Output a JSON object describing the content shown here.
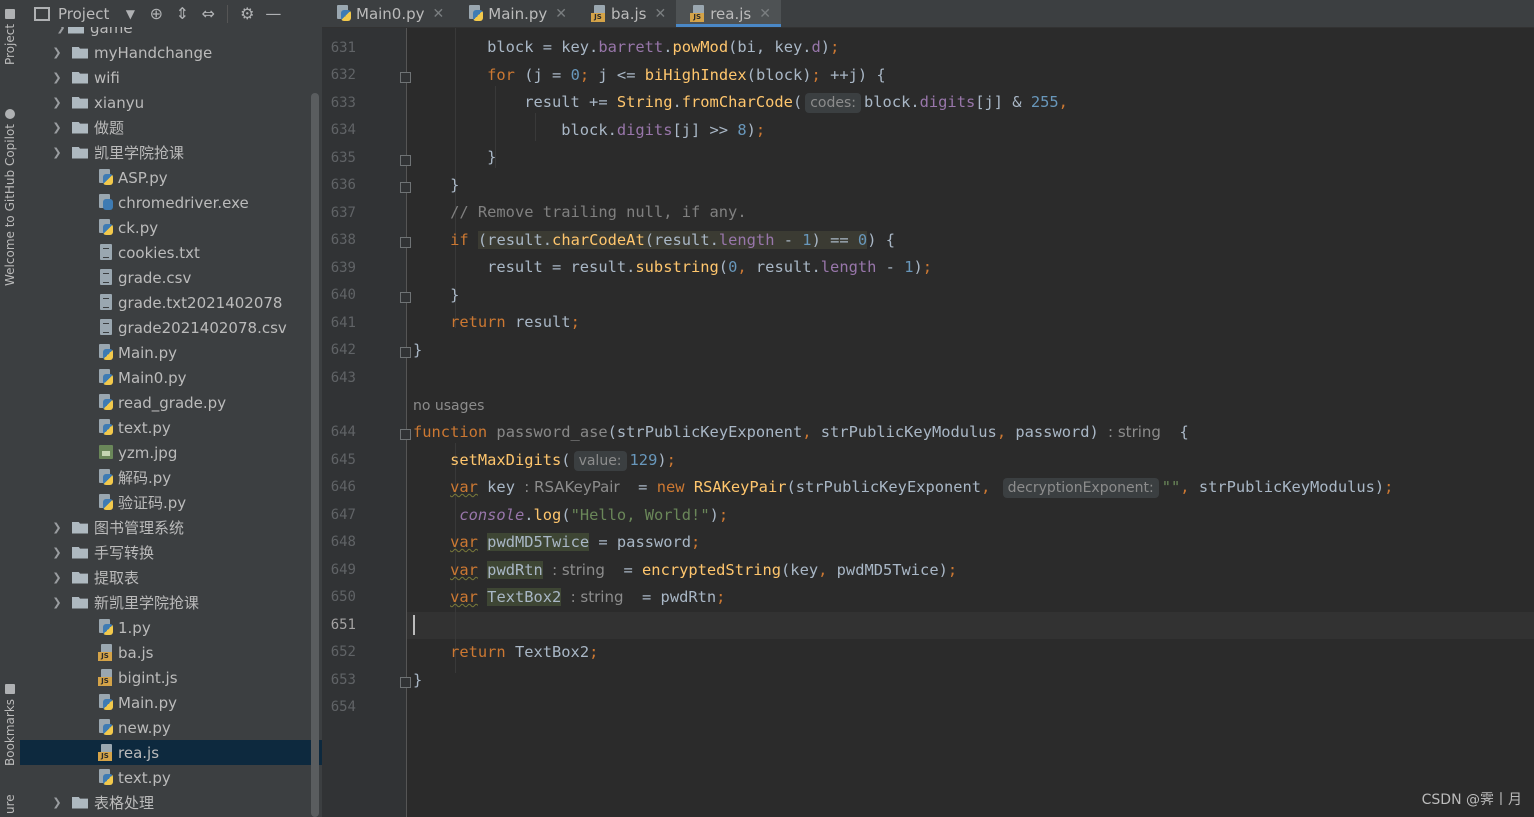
{
  "sidebar_strip": {
    "project_label": "Project",
    "copilot_label": "Welcome to GitHub Copilot",
    "bookmarks_label": "Bookmarks",
    "structure_label": "ure"
  },
  "project_panel": {
    "title": "Project",
    "nodes": [
      {
        "label": "game"
      },
      {
        "label": "myHandchange"
      },
      {
        "label": "wifi"
      },
      {
        "label": "xianyu"
      },
      {
        "label": "做题"
      },
      {
        "label": "凯里学院抢课"
      },
      {
        "label": "ASP.py"
      },
      {
        "label": "chromedriver.exe"
      },
      {
        "label": "ck.py"
      },
      {
        "label": "cookies.txt"
      },
      {
        "label": "grade.csv"
      },
      {
        "label": "grade.txt2021402078"
      },
      {
        "label": "grade2021402078.csv"
      },
      {
        "label": "Main.py"
      },
      {
        "label": "Main0.py"
      },
      {
        "label": "read_grade.py"
      },
      {
        "label": "text.py"
      },
      {
        "label": "yzm.jpg"
      },
      {
        "label": "解码.py"
      },
      {
        "label": "验证码.py"
      },
      {
        "label": "图书管理系统"
      },
      {
        "label": "手写转换"
      },
      {
        "label": "提取表"
      },
      {
        "label": "新凯里学院抢课"
      },
      {
        "label": "1.py"
      },
      {
        "label": "ba.js"
      },
      {
        "label": "bigint.js"
      },
      {
        "label": "Main.py"
      },
      {
        "label": "new.py"
      },
      {
        "label": "rea.js"
      },
      {
        "label": "text.py"
      },
      {
        "label": "表格处理"
      }
    ]
  },
  "tabs": [
    {
      "label": "Main0.py"
    },
    {
      "label": "Main.py"
    },
    {
      "label": "ba.js"
    },
    {
      "label": "rea.js",
      "active": true
    }
  ],
  "editor": {
    "line_numbers": [
      "631",
      "632",
      "633",
      "634",
      "635",
      "636",
      "637",
      "638",
      "639",
      "640",
      "641",
      "642",
      "643",
      "644",
      "645",
      "646",
      "647",
      "648",
      "649",
      "650",
      "651",
      "652",
      "653",
      "654"
    ],
    "current_line": "651",
    "usages_label": "no usages",
    "hints": {
      "codes": "codes:",
      "return_type": ": string",
      "value": "value:",
      "key_type": ": RSAKeyPair",
      "decryption_exponent": "decryptionExponent:",
      "rtn_type": ": string",
      "tb_type": ": string"
    }
  },
  "watermark": "CSDN @霁丨月"
}
